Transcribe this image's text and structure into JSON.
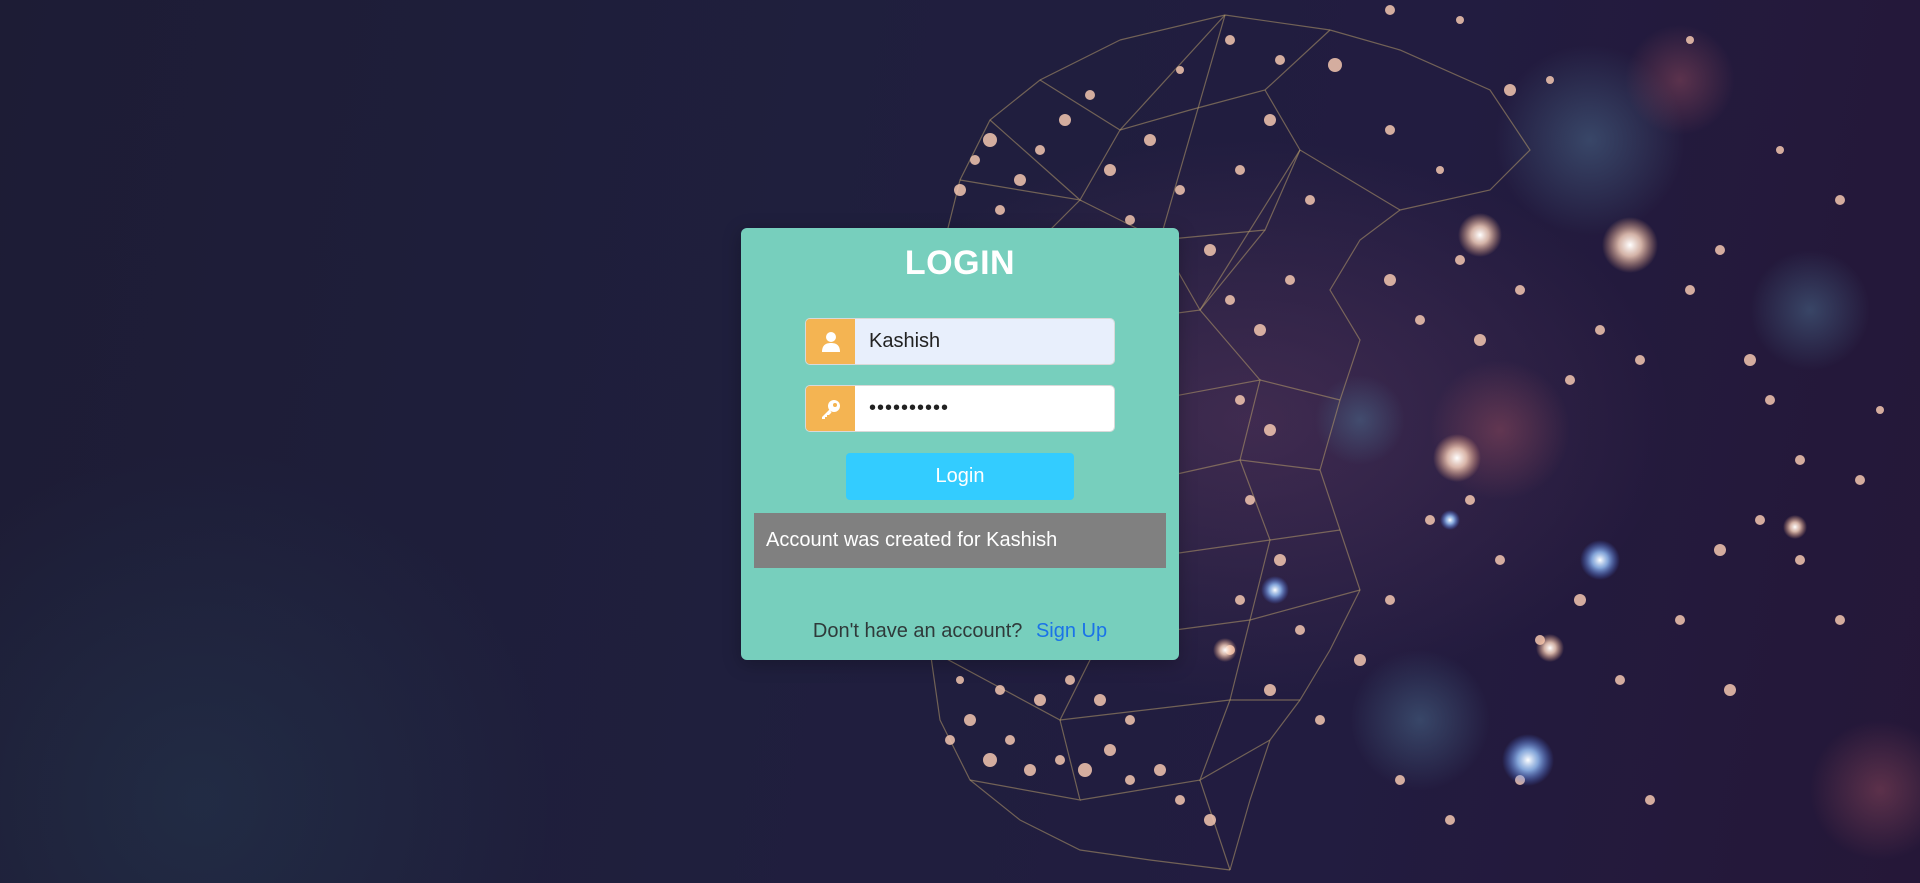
{
  "background": {
    "description_icon": "polygon-head-with-bokeh-lights"
  },
  "login_card": {
    "title": "LOGIN",
    "username": {
      "value": "Kashish",
      "icon": "user-icon"
    },
    "password": {
      "value": "••••••••••",
      "icon": "key-icon"
    },
    "submit_label": "Login",
    "message": "Account was created for Kashish",
    "footer_text": "Don't have an account?",
    "signup_link": "Sign Up"
  },
  "colors": {
    "card": "#77cfbd",
    "addon": "#f4b452",
    "button": "#33ccff",
    "message_bg": "#808080",
    "link": "#1a73e8"
  }
}
